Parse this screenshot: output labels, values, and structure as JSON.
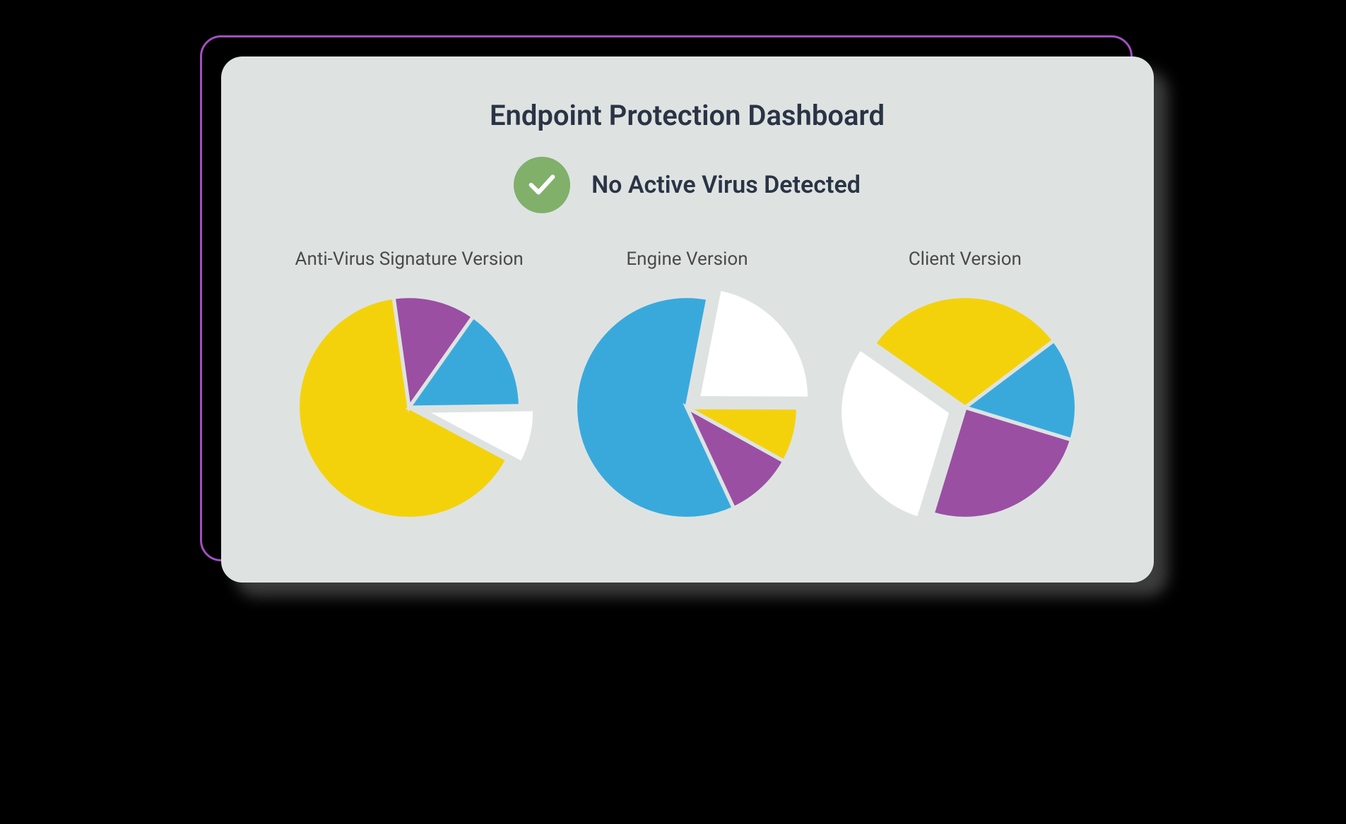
{
  "dashboard": {
    "title": "Endpoint Protection Dashboard",
    "status": {
      "icon": "check-icon",
      "text": "No Active Virus Detected",
      "color": "#80b06a"
    },
    "charts": [
      {
        "label": "Anti-Virus Signature Version"
      },
      {
        "label": "Engine Version"
      },
      {
        "label": "Client Version"
      }
    ]
  },
  "colors": {
    "yellow": "#f4d20b",
    "purple": "#9a4fa3",
    "blue": "#39a9dc",
    "white": "#ffffff",
    "gap": "#dee3e2"
  },
  "chart_data": [
    {
      "type": "pie",
      "title": "Anti-Virus Signature Version",
      "series": [
        {
          "name": "yellow",
          "value": 65,
          "color": "#f4d20b"
        },
        {
          "name": "purple",
          "value": 12,
          "color": "#9a4fa3"
        },
        {
          "name": "blue",
          "value": 15,
          "color": "#39a9dc"
        },
        {
          "name": "white",
          "value": 8,
          "color": "#ffffff",
          "exploded": true
        }
      ],
      "start_angle_deg": 118
    },
    {
      "type": "pie",
      "title": "Engine Version",
      "series": [
        {
          "name": "blue",
          "value": 60,
          "color": "#39a9dc"
        },
        {
          "name": "white",
          "value": 22,
          "color": "#ffffff",
          "exploded": true
        },
        {
          "name": "yellow",
          "value": 8,
          "color": "#f4d20b"
        },
        {
          "name": "purple",
          "value": 10,
          "color": "#9a4fa3"
        }
      ],
      "start_angle_deg": 155
    },
    {
      "type": "pie",
      "title": "Client Version",
      "series": [
        {
          "name": "yellow",
          "value": 30,
          "color": "#f4d20b"
        },
        {
          "name": "blue",
          "value": 15,
          "color": "#39a9dc"
        },
        {
          "name": "purple",
          "value": 25,
          "color": "#9a4fa3"
        },
        {
          "name": "white",
          "value": 30,
          "color": "#ffffff",
          "exploded": true
        }
      ],
      "start_angle_deg": -55
    }
  ]
}
